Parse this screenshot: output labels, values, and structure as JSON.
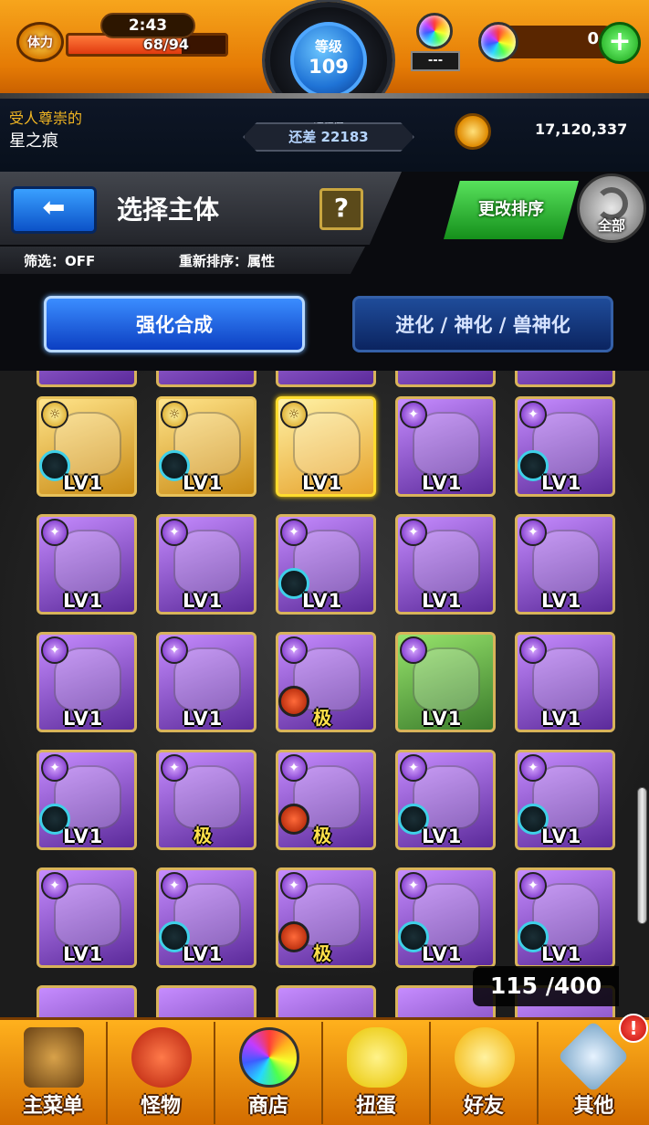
{
  "topbar": {
    "stamina_label": "体力",
    "timer": "2:43",
    "stamina": "68/94",
    "stamina_fraction": 0.72,
    "level_label": "等级",
    "level": "109",
    "exp_label": "经验值",
    "exp_remaining": "还差 22183",
    "gacha_slot": "---",
    "orbs": "0",
    "plus": "+"
  },
  "player": {
    "title": "受人尊崇的",
    "name": "星之痕",
    "gold": "17,120,337"
  },
  "header": {
    "back": "⬅",
    "title": "选择主体",
    "help": "?",
    "filter": "筛选：OFF",
    "sort": "重新排序：属性",
    "reorder": "更改排序",
    "all": "全部"
  },
  "tabs": {
    "active": "强化合成",
    "inactive": "进化 / 神化 / 兽神化"
  },
  "colors": {
    "top_orange": "#f29a12",
    "nav_orange": "#ffb11d",
    "tab_blue": "#1a63e0",
    "reorder_green": "#2cbb2f"
  },
  "monsters": [
    {
      "frame": "gold",
      "element": "light",
      "gauge": "blue",
      "label": "LV1"
    },
    {
      "frame": "gold",
      "element": "light",
      "gauge": "blue",
      "label": "LV1"
    },
    {
      "frame": "gold-sel",
      "element": "light",
      "gauge": "none",
      "label": "LV1"
    },
    {
      "frame": "purple",
      "element": "dark",
      "gauge": "none",
      "label": "LV1"
    },
    {
      "frame": "purple",
      "element": "dark",
      "gauge": "blue",
      "label": "LV1"
    },
    {
      "frame": "purple",
      "element": "dark",
      "gauge": "none",
      "label": "LV1"
    },
    {
      "frame": "purple",
      "element": "dark",
      "gauge": "none",
      "label": "LV1"
    },
    {
      "frame": "purple",
      "element": "dark",
      "gauge": "blue",
      "label": "LV1"
    },
    {
      "frame": "purple",
      "element": "dark",
      "gauge": "none",
      "label": "LV1"
    },
    {
      "frame": "purple",
      "element": "dark",
      "gauge": "none",
      "label": "LV1"
    },
    {
      "frame": "purple",
      "element": "dark",
      "gauge": "none",
      "label": "LV1"
    },
    {
      "frame": "purple",
      "element": "dark",
      "gauge": "none",
      "label": "LV1"
    },
    {
      "frame": "purple",
      "element": "dark",
      "gauge": "red",
      "label": "极"
    },
    {
      "frame": "green",
      "element": "dark",
      "gauge": "none",
      "label": "LV1"
    },
    {
      "frame": "purple",
      "element": "dark",
      "gauge": "none",
      "label": "LV1"
    },
    {
      "frame": "purple",
      "element": "dark",
      "gauge": "blue",
      "label": "LV1"
    },
    {
      "frame": "purple",
      "element": "dark",
      "gauge": "none",
      "label": "极"
    },
    {
      "frame": "purple",
      "element": "dark",
      "gauge": "red",
      "label": "极"
    },
    {
      "frame": "purple",
      "element": "dark",
      "gauge": "blue",
      "label": "LV1"
    },
    {
      "frame": "purple",
      "element": "dark",
      "gauge": "blue",
      "label": "LV1"
    },
    {
      "frame": "purple",
      "element": "dark",
      "gauge": "none",
      "label": "LV1"
    },
    {
      "frame": "purple",
      "element": "dark",
      "gauge": "blue",
      "label": "LV1"
    },
    {
      "frame": "purple",
      "element": "dark",
      "gauge": "red",
      "label": "极"
    },
    {
      "frame": "purple",
      "element": "dark",
      "gauge": "blue",
      "label": "LV1"
    },
    {
      "frame": "purple",
      "element": "dark",
      "gauge": "blue",
      "label": "LV1"
    }
  ],
  "box_count": "115 /400",
  "nav": {
    "main_menu": "主菜单",
    "monsters": "怪物",
    "shop": "商店",
    "gacha": "扭蛋",
    "friends": "好友",
    "other": "其他",
    "notify": "!"
  }
}
